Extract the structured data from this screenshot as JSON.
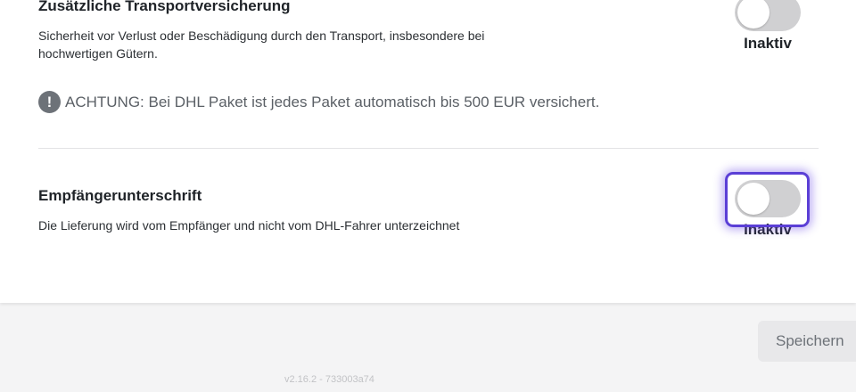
{
  "sections": [
    {
      "title": "Zusätzliche Transportversicherung",
      "description": "Sicherheit vor Verlust oder Beschädigung durch den Transport, insbesondere bei hochwertigen Gütern.",
      "toggle_label": "Inaktiv",
      "toggle_on": false
    },
    {
      "title": "Empfängerunterschrift",
      "description": "Die Lieferung wird vom Empfänger und nicht vom DHL-Fahrer unterzeichnet",
      "toggle_label": "Inaktiv",
      "toggle_on": false
    }
  ],
  "notice": {
    "icon": "exclamation-icon",
    "glyph": "!",
    "text": "ACHTUNG: Bei DHL Paket ist jedes Paket automatisch bis 500 EUR versichert."
  },
  "footer": {
    "save_label": "Speichern",
    "version": "v2.16.2 - 733003a74"
  },
  "colors": {
    "focus_ring": "#5b3fd6",
    "toggle_off": "#d0d0d2"
  }
}
